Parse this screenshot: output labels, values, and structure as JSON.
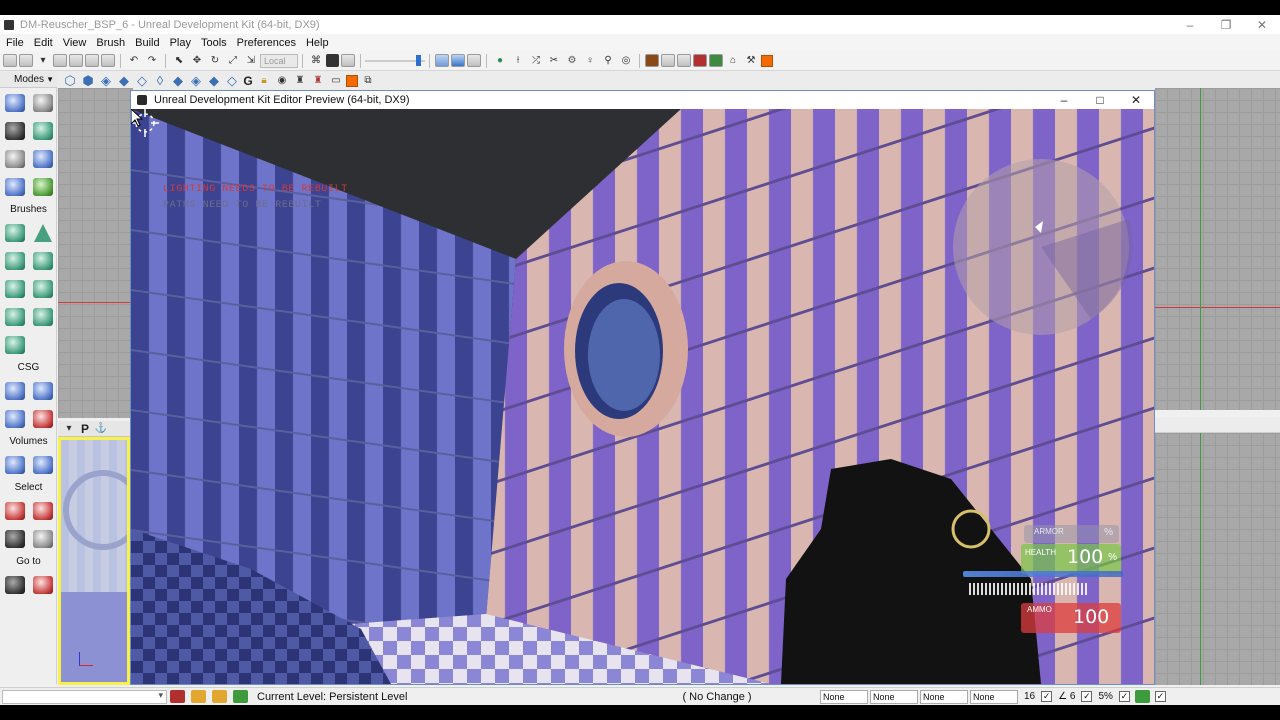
{
  "window": {
    "title": "DM-Reuscher_BSP_6 - Unreal Development Kit (64-bit, DX9)",
    "minimize": "–",
    "maximize": "❐",
    "close": "✕"
  },
  "menu": [
    "File",
    "Edit",
    "View",
    "Brush",
    "Build",
    "Play",
    "Tools",
    "Preferences",
    "Help"
  ],
  "toolbar": {
    "coord_system": "Local",
    "viewport_type_letter": "P",
    "show_flag_letter": "S",
    "front_letter": "F",
    "geometry_letter": "G",
    "kismet_letter": "K"
  },
  "left_panel": {
    "modes_label": "Modes",
    "brushes_label": "Brushes",
    "csg_label": "CSG",
    "volumes_label": "Volumes",
    "select_label": "Select",
    "goto_label": "Go to"
  },
  "preview": {
    "title": "Unreal Development Kit Editor Preview (64-bit, DX9)",
    "minimize": "–",
    "maximize": "□",
    "close": "✕",
    "messages": {
      "lighting": "LIGHTING NEEDS TO BE REBUILT",
      "paths": "PATHS NEED TO BE REBUILT"
    },
    "hud": {
      "armor_label": "ARMOR",
      "armor_unit": "%",
      "health_label": "HEALTH",
      "health_value": "100",
      "health_unit": "%",
      "ammo_label": "AMMO",
      "ammo_value": "100"
    }
  },
  "status": {
    "current_level": "Current Level:  Persistent Level",
    "no_change": "( No Change )",
    "boxes": [
      "None",
      "None",
      "None",
      "None"
    ],
    "grid_size": "16",
    "rotation_snap": "∠ 6",
    "scale_snap": "5%"
  },
  "colors": {
    "accent_orange": "#f26a00",
    "viewport_selected": "#f7f14a",
    "lighting_warning": "#d23a3a",
    "health_green": "#78c846",
    "ammo_red": "#dc3c3c"
  }
}
